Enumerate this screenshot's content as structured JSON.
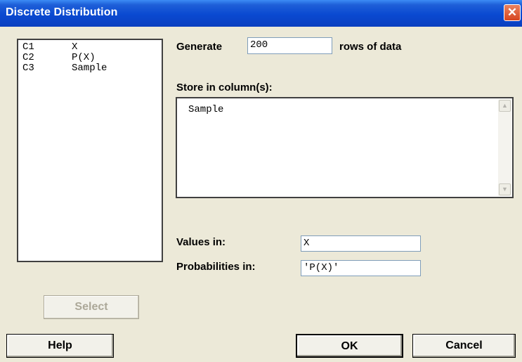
{
  "window": {
    "title": "Discrete Distribution",
    "close_glyph": "✕"
  },
  "columns_list": [
    {
      "col": "C1",
      "name": "X"
    },
    {
      "col": "C2",
      "name": "P(X)"
    },
    {
      "col": "C3",
      "name": "Sample"
    }
  ],
  "generate": {
    "label": "Generate",
    "value": "200",
    "suffix": "rows of data"
  },
  "store": {
    "label": "Store in column(s):",
    "value": "Sample"
  },
  "values_in": {
    "label": "Values in:",
    "value": "X"
  },
  "probabilities_in": {
    "label": "Probabilities in:",
    "value": "'P(X)'"
  },
  "buttons": {
    "select": "Select",
    "help": "Help",
    "ok": "OK",
    "cancel": "Cancel"
  },
  "icons": {
    "scroll_up": "chevron-up-icon",
    "scroll_down": "chevron-down-icon",
    "close": "close-icon"
  }
}
